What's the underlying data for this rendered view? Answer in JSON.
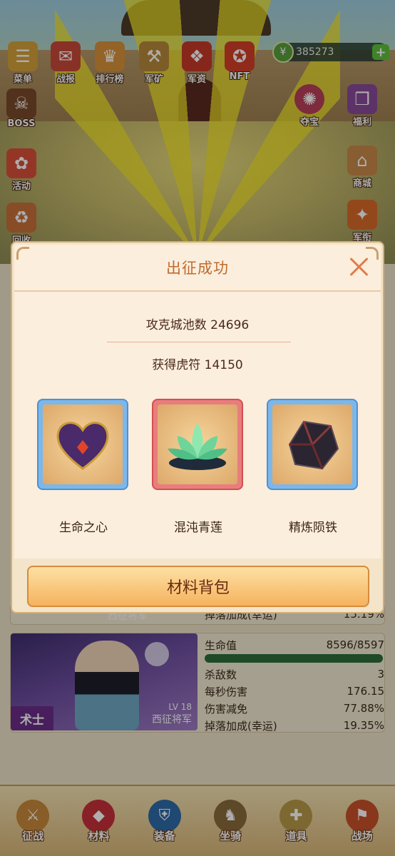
{
  "top_menu": [
    {
      "label": "菜单",
      "icon": "menu-book-icon"
    },
    {
      "label": "战报",
      "icon": "battle-report-icon"
    },
    {
      "label": "排行榜",
      "icon": "ranking-icon"
    },
    {
      "label": "军矿",
      "icon": "pickaxe-icon"
    },
    {
      "label": "军资",
      "icon": "supplies-icon"
    },
    {
      "label": "NFT",
      "icon": "nft-icon"
    }
  ],
  "currency": {
    "amount": "385273",
    "plus": "+"
  },
  "side_left": [
    {
      "label": "BOSS",
      "icon": "boss-icon"
    },
    {
      "label": "活动",
      "icon": "event-icon"
    },
    {
      "label": "回收",
      "icon": "recycle-icon"
    }
  ],
  "side_right": [
    {
      "label": "夺宝",
      "icon": "treasure-wheel-icon"
    },
    {
      "label": "福利",
      "icon": "gift-icon"
    },
    {
      "label": "商城",
      "icon": "shop-icon"
    },
    {
      "label": "军衔",
      "icon": "rank-badge-icon"
    }
  ],
  "modal": {
    "title": "出征成功",
    "captured_cities": "攻克城池数 24696",
    "tiger_tally": "获得虎符 14150",
    "rewards": [
      {
        "name": "生命之心",
        "icon": "heart-gem-icon",
        "frame": "blue"
      },
      {
        "name": "混沌青莲",
        "icon": "lotus-icon",
        "frame": "red"
      },
      {
        "name": "精炼陨铁",
        "icon": "meteor-iron-icon",
        "frame": "blue"
      }
    ],
    "bag_button": "材料背包"
  },
  "card_partial": {
    "rank": "西征将军",
    "drop_label": "掉落加成(幸运)",
    "drop_value": "15.19%"
  },
  "card": {
    "class_label": "术士",
    "level": "LV 18",
    "rank": "西征将军",
    "hp_label": "生命值",
    "hp_value": "8596/8597",
    "hp_fraction": 0.9999,
    "kills_label": "杀敌数",
    "kills_value": "3",
    "dps_label": "每秒伤害",
    "dps_value": "176.15",
    "dr_label": "伤害减免",
    "dr_value": "77.88%",
    "drop_label": "掉落加成(幸运)",
    "drop_value": "19.35%"
  },
  "bottom_nav": [
    {
      "label": "征战",
      "icon": "crossed-swords-icon"
    },
    {
      "label": "材料",
      "icon": "ruby-icon"
    },
    {
      "label": "装备",
      "icon": "armor-icon"
    },
    {
      "label": "坐骑",
      "icon": "mount-icon"
    },
    {
      "label": "道具",
      "icon": "bag-icon"
    },
    {
      "label": "战场",
      "icon": "battlefield-icon"
    }
  ],
  "colors": {
    "accent": "#c06a2c",
    "hp_bar": "#2e6e3a",
    "frame_blue": "#7bb7ea",
    "frame_red": "#e87d7d"
  }
}
